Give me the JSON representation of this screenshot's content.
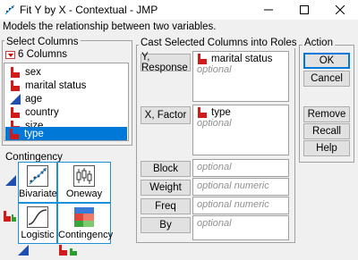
{
  "window": {
    "title": "Fit Y by X - Contextual - JMP",
    "subtitle": "Models the relationship between two variables.",
    "controls": [
      "minimize-icon",
      "maximize-icon",
      "close-icon"
    ]
  },
  "select_columns": {
    "title": "Select Columns",
    "count_label": "6 Columns",
    "columns": [
      {
        "name": "sex",
        "type": "nominal",
        "selected": false
      },
      {
        "name": "marital status",
        "type": "nominal",
        "selected": false
      },
      {
        "name": "age",
        "type": "continuous",
        "selected": false
      },
      {
        "name": "country",
        "type": "nominal",
        "selected": false
      },
      {
        "name": "size",
        "type": "nominal",
        "selected": false
      },
      {
        "name": "type",
        "type": "nominal",
        "selected": true
      }
    ]
  },
  "cast_roles": {
    "title": "Cast Selected Columns into Roles",
    "roles": [
      {
        "button": "Y, Response",
        "value": "marital status",
        "placeholder": "optional"
      },
      {
        "button": "X, Factor",
        "value": "type",
        "placeholder": "optional"
      },
      {
        "button": "Block",
        "placeholder": "optional"
      },
      {
        "button": "Weight",
        "placeholder": "optional numeric"
      },
      {
        "button": "Freq",
        "placeholder": "optional numeric"
      },
      {
        "button": "By",
        "placeholder": "optional"
      }
    ]
  },
  "action": {
    "title": "Action",
    "buttons": [
      "OK",
      "Cancel",
      "Remove",
      "Recall",
      "Help"
    ]
  },
  "contingency": {
    "title": "Contingency",
    "tiles": [
      {
        "label": "Bivariate",
        "icon": "scatter-plot-icon"
      },
      {
        "label": "Oneway",
        "icon": "box-plot-icon"
      },
      {
        "label": "Logistic",
        "icon": "logistic-curve-icon"
      },
      {
        "label": "Contingency",
        "icon": "mosaic-plot-icon"
      }
    ]
  },
  "colors": {
    "accent": "#0078d7",
    "nominal_icon": "#d11a1a",
    "continuous_icon": "#1f4fb0",
    "tile_border": "#1e90d8"
  }
}
